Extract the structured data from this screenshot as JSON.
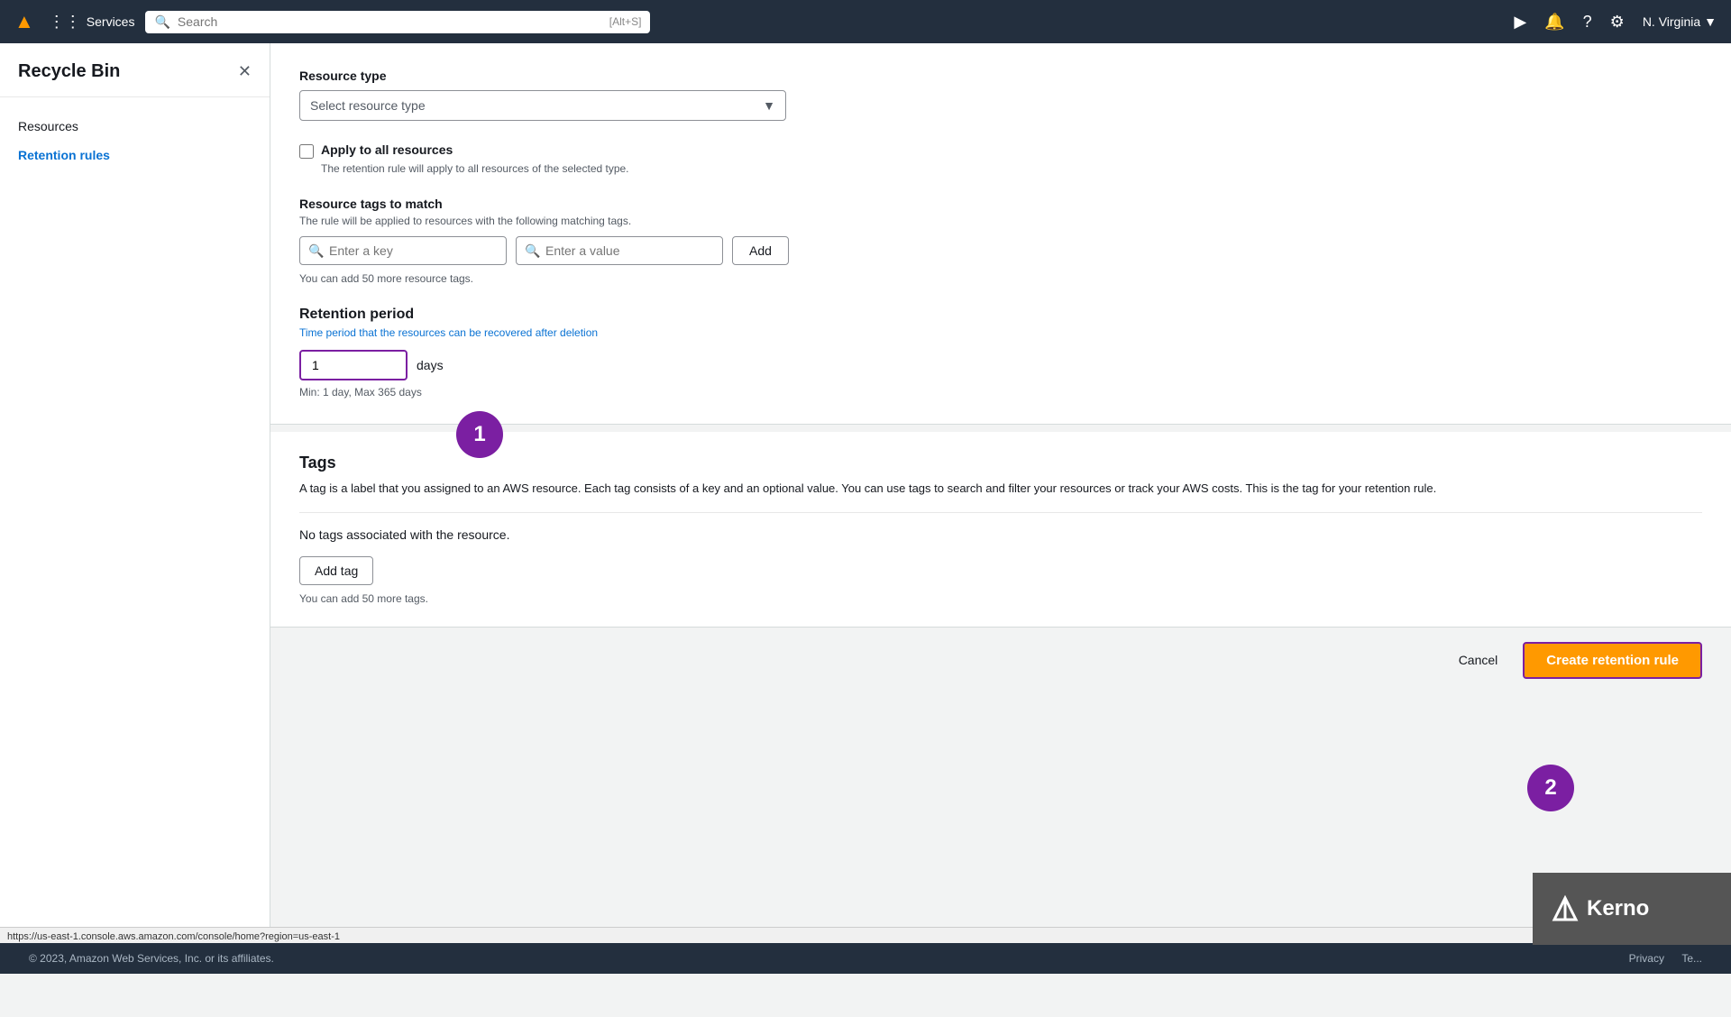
{
  "topnav": {
    "logo": "aws",
    "grid_icon": "⊞",
    "services_label": "Services",
    "search_placeholder": "Search",
    "search_shortcut": "[Alt+S]",
    "nav_icons": [
      "▶",
      "🔔",
      "?",
      "⚙"
    ],
    "region": "N. Virginia",
    "region_arrow": "▼"
  },
  "sidebar": {
    "title": "Recycle Bin",
    "close_icon": "✕",
    "nav_items": [
      {
        "id": "resources",
        "label": "Resources",
        "active": false
      },
      {
        "id": "retention-rules",
        "label": "Retention rules",
        "active": true
      }
    ]
  },
  "form": {
    "resource_type": {
      "label": "Resource type",
      "placeholder": "Select resource type"
    },
    "apply_all": {
      "label": "Apply to all resources",
      "description": "The retention rule will apply to all resources of the selected type."
    },
    "resource_tags": {
      "label": "Resource tags to match",
      "description": "The rule will be applied to resources with the following matching tags.",
      "key_placeholder": "Enter a key",
      "value_placeholder": "Enter a value",
      "add_label": "Add",
      "hint": "You can add 50 more resource tags."
    },
    "retention_period": {
      "label": "Retention period",
      "description": "Time period that the resources can be recovered after deletion",
      "value": "1",
      "unit": "days",
      "hint": "Min: 1 day, Max 365 days"
    }
  },
  "tags_section": {
    "title": "Tags",
    "description": "A tag is a label that you assigned to an AWS resource. Each tag consists of a key and an optional value. You can use tags to search and filter your resources or track your AWS costs. This is the tag for your retention rule.",
    "no_tags_message": "No tags associated with the resource.",
    "add_tag_label": "Add tag",
    "add_tag_hint": "You can add 50 more tags."
  },
  "actions": {
    "cancel_label": "Cancel",
    "create_label": "Create retention rule"
  },
  "steps": {
    "step1": "1",
    "step2": "2"
  },
  "footer": {
    "copyright": "© 2023, Amazon Web Services, Inc. or its affiliates.",
    "privacy_label": "Privacy",
    "terms_label": "Te..."
  },
  "statusbar": {
    "url": "https://us-east-1.console.aws.amazon.com/console/home?region=us-east-1"
  },
  "kerno": {
    "label": "Kerno"
  }
}
